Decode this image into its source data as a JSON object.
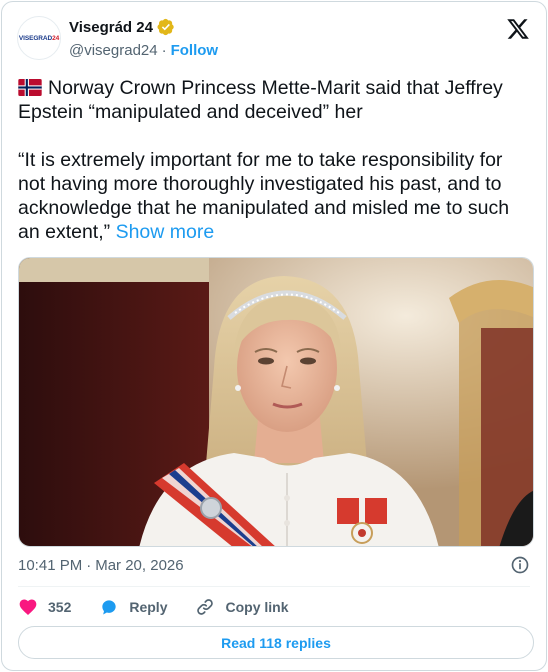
{
  "author": {
    "avatar_text_main": "VISEGRAD",
    "avatar_text_accent": "24",
    "name": "Visegrád 24",
    "verified_icon": "verified-badge-icon",
    "verified_color": "#e2b719",
    "handle": "@visegrad24",
    "separator": "·",
    "follow_label": "Follow"
  },
  "tweet": {
    "flag_icon": "norway-flag-icon",
    "line1": "Norway Crown Princess Mette-Marit said that Jeffrey Epstein “manipulated and deceived” her",
    "quote": "“It is extremely important for me to take responsibility for not having more thoroughly investigated his past, and to acknowledge that he manipulated and misled me to such an extent,”",
    "show_more": "Show more"
  },
  "photo": {
    "subject": "photo of Crown Princess Mette-Marit wearing a tiara and red sash"
  },
  "meta": {
    "time": "10:41 PM",
    "separator": "·",
    "date": "Mar 20, 2026"
  },
  "actions": {
    "like_count": "352",
    "reply_label": "Reply",
    "copy_label": "Copy link"
  },
  "replies_button": "Read 118 replies",
  "colors": {
    "accent": "#1d9bf0",
    "like": "#f91880",
    "text_secondary": "#536471",
    "border": "#cfd9de"
  }
}
